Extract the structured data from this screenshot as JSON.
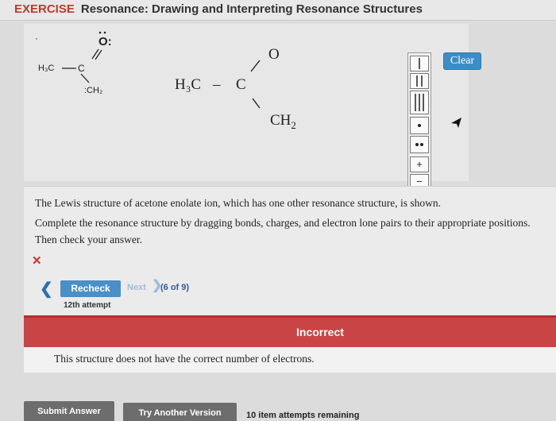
{
  "header": {
    "prefix": "EXERCISE",
    "title": "Resonance: Drawing and Interpreting Resonance Structures"
  },
  "sketch": {
    "oxygen": "O:",
    "methyl": "H₃C",
    "carbon": "C",
    "ch2": ":CH₂"
  },
  "molecule": {
    "methyl": "H₃C",
    "bond": "–",
    "carbon": "C",
    "oxygen": "O",
    "ch2_main": "CH",
    "ch2_sub": "2"
  },
  "toolbar": {
    "clear_label": "Clear",
    "charge_plus": "+",
    "charge_minus": "−"
  },
  "instructions": {
    "line1": "The Lewis structure of acetone enolate ion, which has one other resonance structure, is shown.",
    "line2": "Complete the resonance structure by dragging bonds, charges, and electron lone pairs to their appropriate positions.",
    "line3": "Then check your answer."
  },
  "status": {
    "x_mark": "✕",
    "back": "❮",
    "recheck_label": "Recheck",
    "next_label": "Next",
    "next_arrow": "❯",
    "progress": "(6 of 9)",
    "attempt": "12th attempt",
    "result": "Incorrect",
    "feedback": "This structure does not have the correct number of electrons."
  },
  "footer": {
    "submit_label": "Submit Answer",
    "try_label": "Try Another Version",
    "remaining": "10 item attempts remaining"
  }
}
